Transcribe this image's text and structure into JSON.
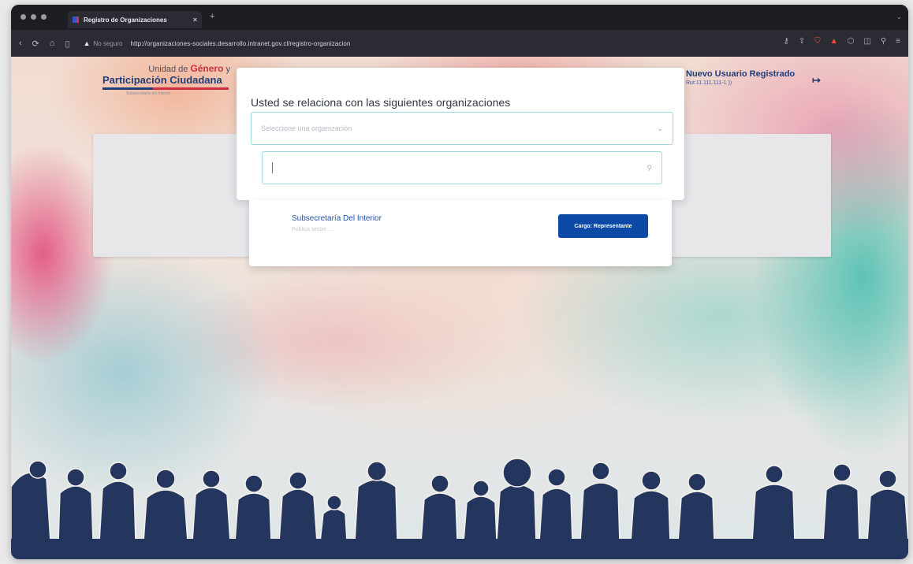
{
  "browser": {
    "tab_title": "Registro de Organizaciones",
    "tab_close": "×",
    "new_tab": "+",
    "security_label": "No seguro",
    "url": "http://organizaciones-sociales.desarrollo.intranet.gov.cl/registro-organizacion"
  },
  "header": {
    "logo_line1_prefix": "Unidad de ",
    "logo_line1_emph": "Género",
    "logo_line1_suffix": " y",
    "logo_line2": "Participación Ciudadana",
    "logo_line3": "Subsecretaría del Interior",
    "user_name": "Nuevo Usuario Registrado",
    "user_rut": "Rut:11.111.111-1 ))",
    "logout_icon": "logout-icon"
  },
  "modal": {
    "title": "Usted se relaciona con las siguientes organizaciones",
    "select_placeholder": "Seleccione una organización",
    "search_value": ""
  },
  "dropdown": {
    "option_name": "Subsecretaría Del Interior",
    "option_sub": "Pública sector ...",
    "button_label": "Cargo: Representante"
  },
  "colors": {
    "brand_blue": "#1f3e7a",
    "brand_red": "#d12e3f",
    "button_blue": "#0c4aa6",
    "input_border": "#9fdbe3"
  }
}
